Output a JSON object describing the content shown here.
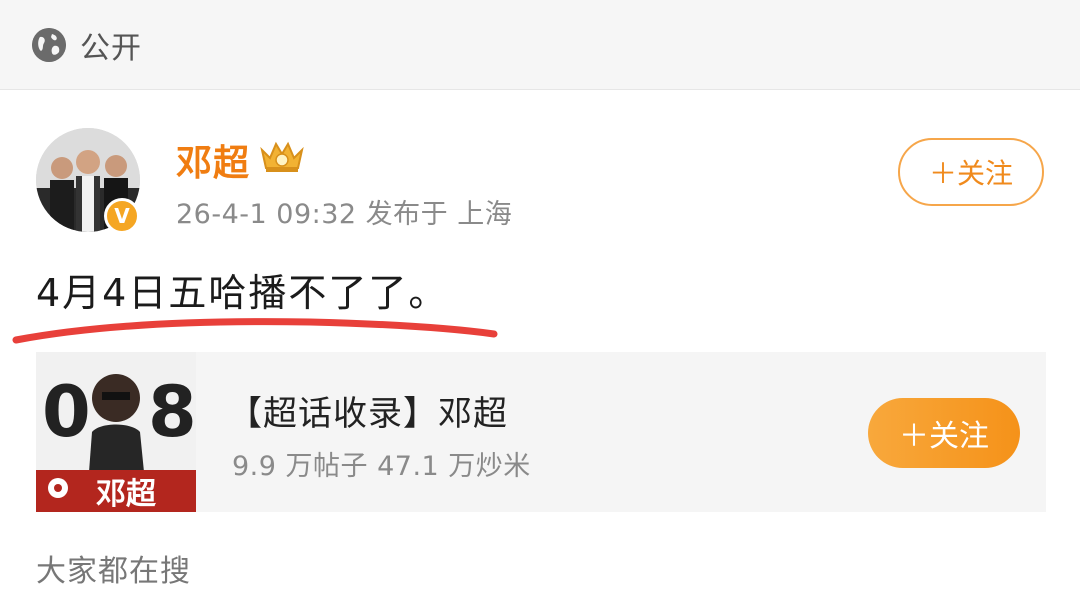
{
  "header": {
    "visibility_icon": "globe-icon",
    "visibility_label": "公开"
  },
  "post": {
    "author": {
      "name": "邓超",
      "badge_icon": "crown-badge-icon",
      "verified_icon": "v-verified-icon",
      "verified_text": "V"
    },
    "meta": "26-4-1 09:32  发布于 上海",
    "follow_label": "＋关注",
    "text": "4月4日五哈播不了了。",
    "highlight_color": "#e8403a"
  },
  "topic_card": {
    "title": "【超话收录】邓超",
    "stats": "9.9 万帖子  47.1 万炒米",
    "follow_label": "＋关注",
    "thumb_text": "邓超"
  },
  "section": {
    "title": "大家都在搜"
  },
  "colors": {
    "accent": "#f07d11",
    "follow_fill": "#f59219"
  }
}
